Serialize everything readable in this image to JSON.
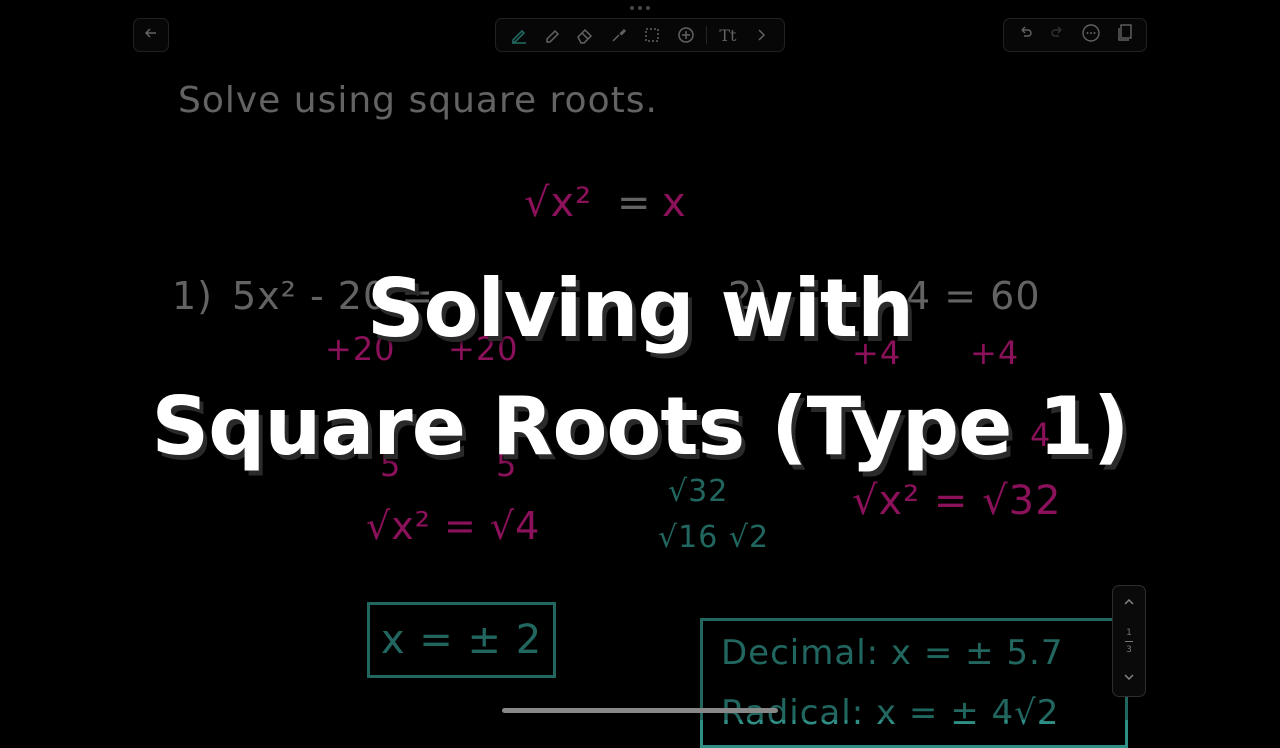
{
  "toolbar": {
    "back_icon": "arrow-left-icon",
    "tools": [
      "pen-icon",
      "highlighter-icon",
      "eraser-icon",
      "lasso-icon",
      "selection-icon",
      "add-icon",
      "text-icon",
      "chevron-right-icon"
    ],
    "text_tool_label": "Tt",
    "right": [
      "undo-icon",
      "redo-icon",
      "more-icon",
      "pages-icon"
    ]
  },
  "whiteboard": {
    "instruction": "Solve using square roots.",
    "identity_lhs": "√x²",
    "identity_eq": "=",
    "identity_rhs": "x",
    "p1_label": "1)",
    "p1_eq": "5x² - 20 =",
    "p1_add_left": "+20",
    "p1_add_right": "+20",
    "p1_div_left": "5",
    "p1_div_right": "5",
    "p1_sqrt": "√x² = √4",
    "p1_answer": "x = ± 2",
    "p2_label": "2)",
    "p2_eq": "4 = 60",
    "p2_add_left": "+4",
    "p2_add_right": "+4",
    "p2_mid": "4",
    "p2_sqrt": "√x² = √32",
    "side_sqrt32": "√32",
    "side_split": "√16 √2",
    "decimal_answer": "Decimal:  x = ± 5.7",
    "radical_answer": "Radical:  x = ± 4√2"
  },
  "overlay": {
    "line1": "Solving with",
    "line2": "Square Roots (Type 1)"
  },
  "page_indicator": {
    "current": "1",
    "total": "3"
  },
  "colors": {
    "gray_ink": "#8a8a8a",
    "pink_ink": "#c2187e",
    "teal_ink": "#2f8f86",
    "active_tool": "#2f8f86"
  }
}
